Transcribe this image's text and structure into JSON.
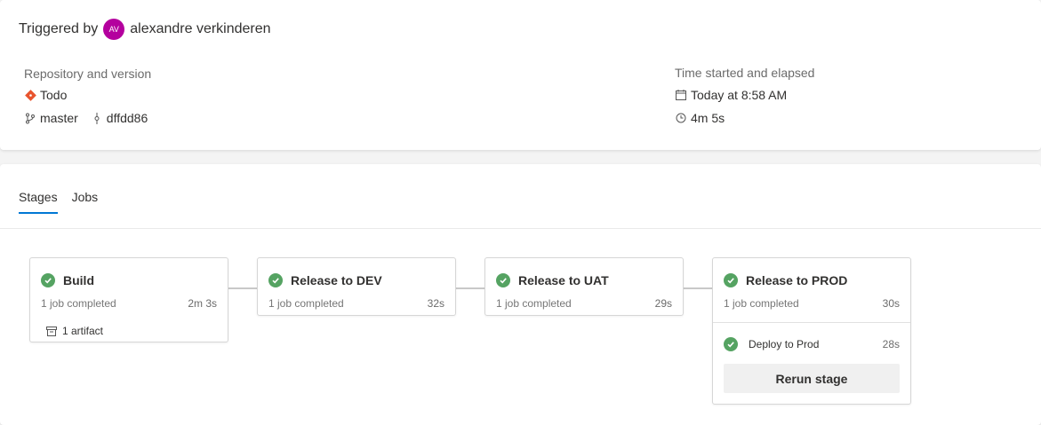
{
  "summary": {
    "triggered_by_label": "Triggered by",
    "user_initials": "AV",
    "user_name": "alexandre verkinderen",
    "repo_label": "Repository and version",
    "repo_name": "Todo",
    "branch": "master",
    "commit": "dffdd86",
    "time_label": "Time started and elapsed",
    "started": "Today at 8:58 AM",
    "elapsed": "4m 5s"
  },
  "tabs": [
    {
      "label": "Stages",
      "active": true
    },
    {
      "label": "Jobs",
      "active": false
    }
  ],
  "stages": [
    {
      "name": "Build",
      "status": "1 job completed",
      "duration": "2m 3s",
      "artifact": "1 artifact"
    },
    {
      "name": "Release to DEV",
      "status": "1 job completed",
      "duration": "32s"
    },
    {
      "name": "Release to UAT",
      "status": "1 job completed",
      "duration": "29s"
    },
    {
      "name": "Release to PROD",
      "status": "1 job completed",
      "duration": "30s",
      "job": {
        "name": "Deploy to Prod",
        "duration": "28s"
      },
      "rerun_label": "Rerun stage"
    }
  ],
  "colors": {
    "success": "#55a362",
    "avatar": "#b4009e",
    "accent": "#0078d4",
    "git_orange": "#e8542e"
  }
}
